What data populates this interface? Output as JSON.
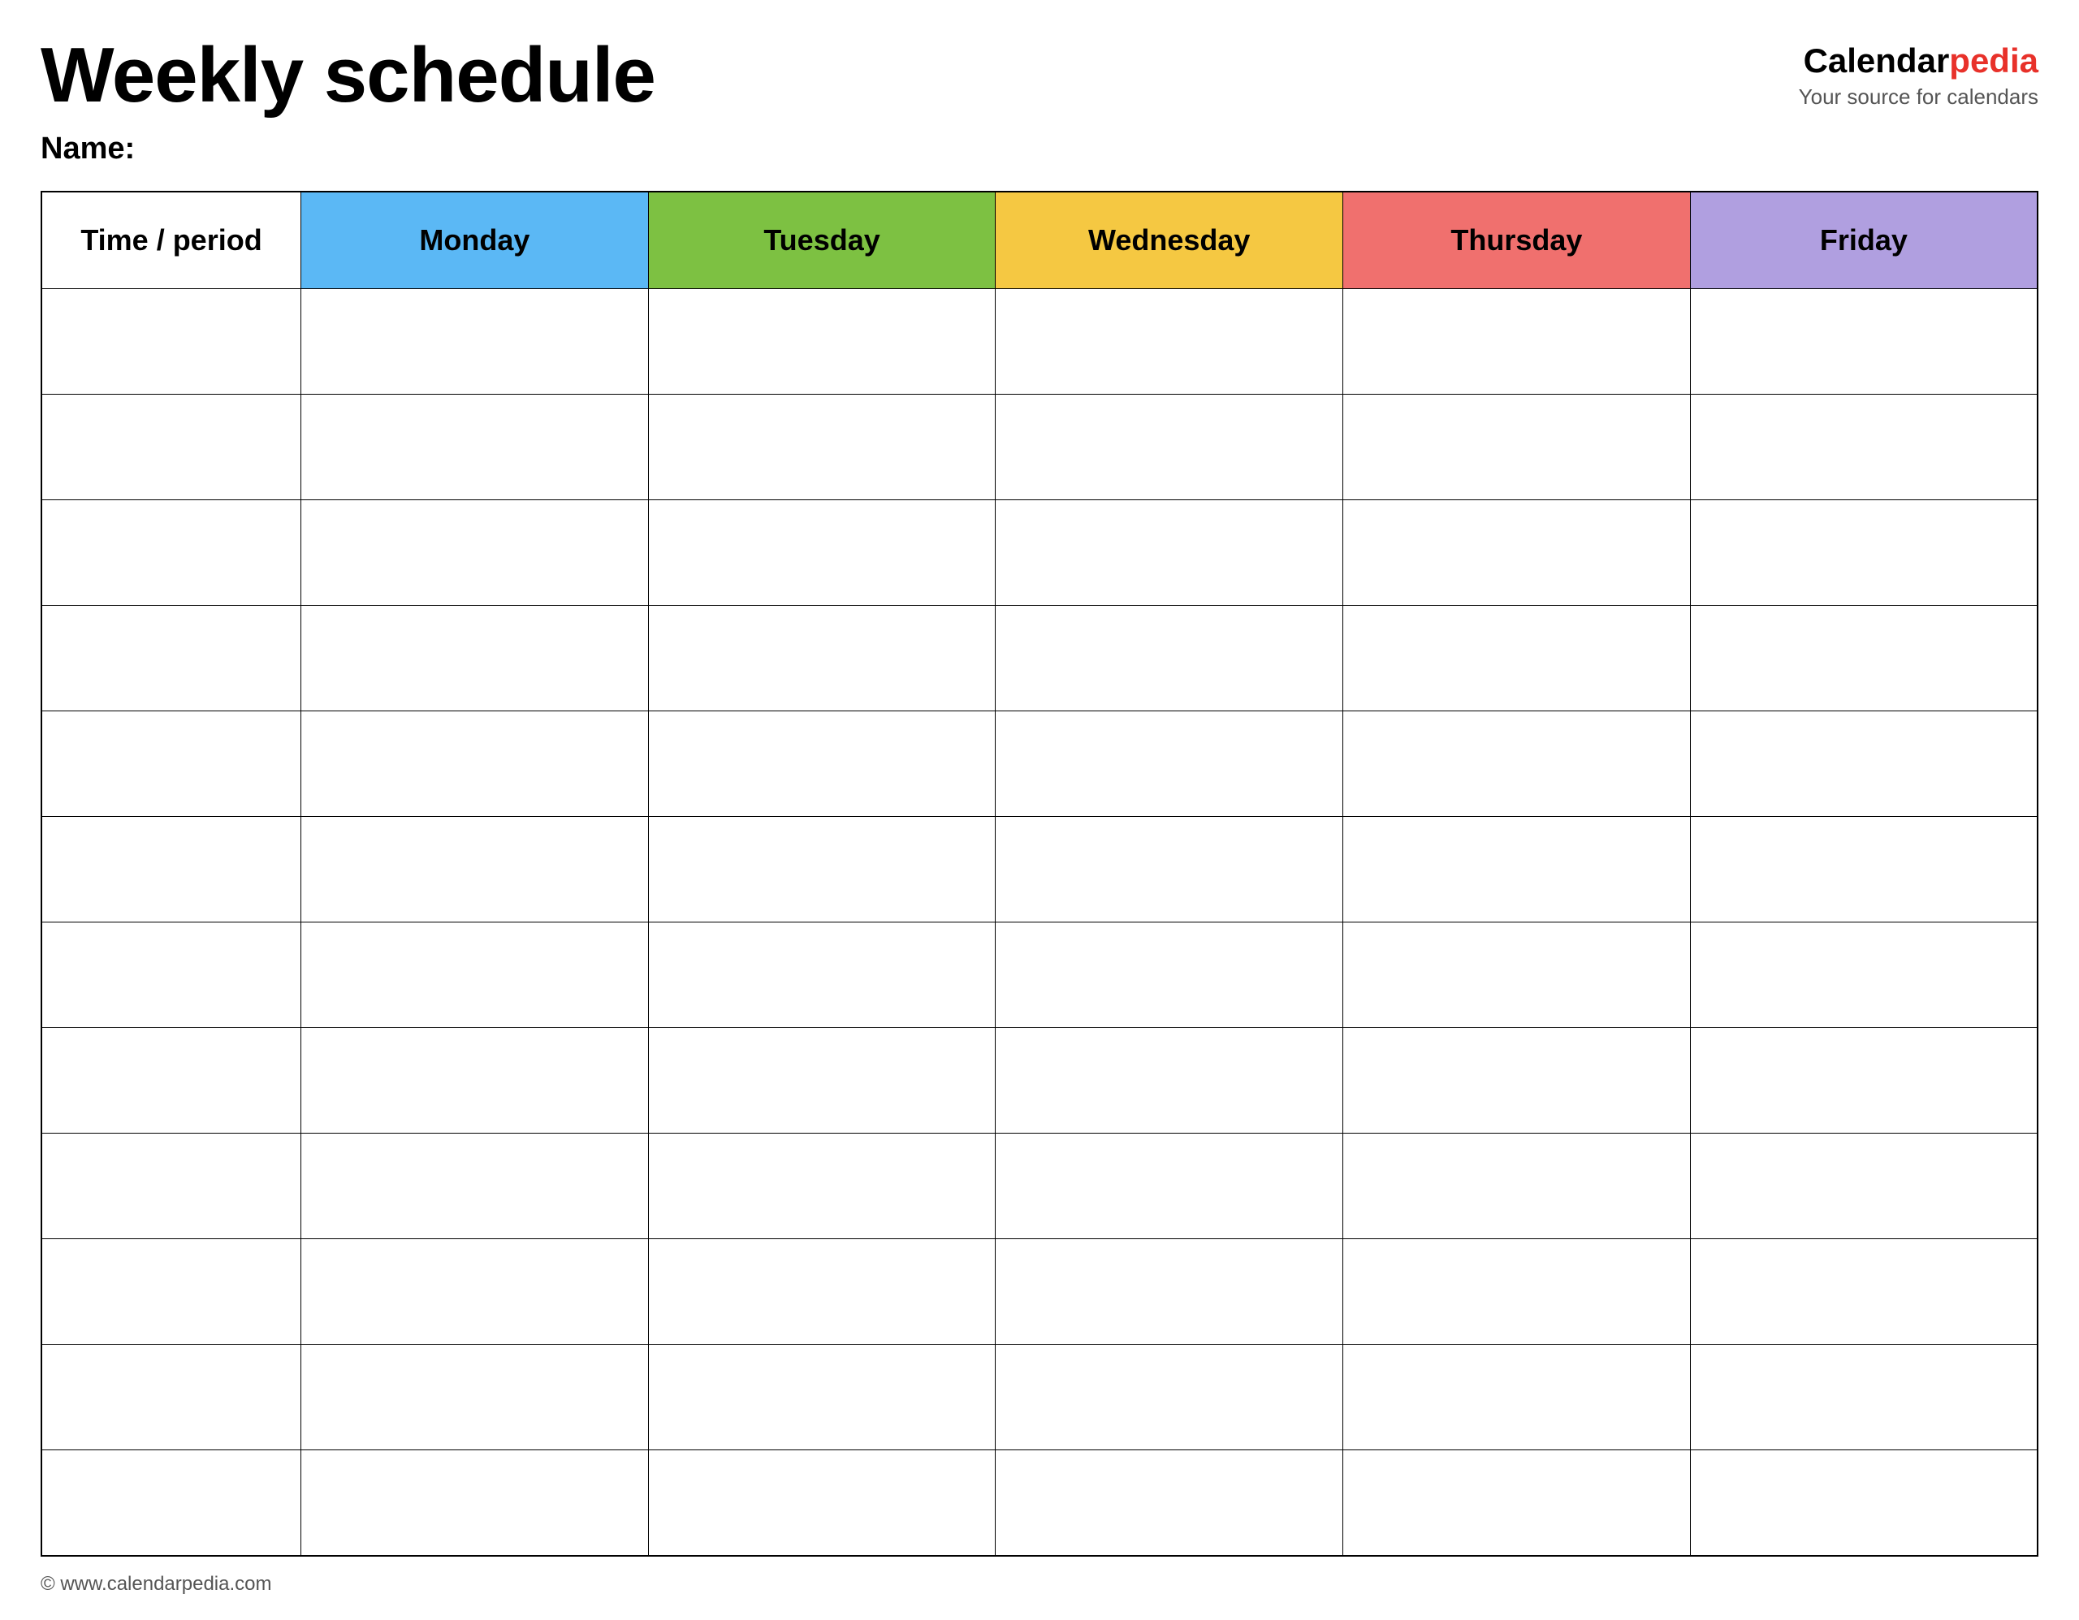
{
  "header": {
    "title": "Weekly schedule",
    "name_label": "Name:",
    "logo_calendar": "Calendar",
    "logo_pedia": "pedia",
    "logo_tagline": "Your source for calendars"
  },
  "table": {
    "columns": [
      {
        "id": "time",
        "label": "Time / period",
        "color": null
      },
      {
        "id": "monday",
        "label": "Monday",
        "color": "#5bb8f5"
      },
      {
        "id": "tuesday",
        "label": "Tuesday",
        "color": "#7dc142"
      },
      {
        "id": "wednesday",
        "label": "Wednesday",
        "color": "#f5c842"
      },
      {
        "id": "thursday",
        "label": "Thursday",
        "color": "#f0706e"
      },
      {
        "id": "friday",
        "label": "Friday",
        "color": "#b09fe0"
      }
    ],
    "row_count": 12
  },
  "footer": {
    "url": "© www.calendarpedia.com"
  }
}
